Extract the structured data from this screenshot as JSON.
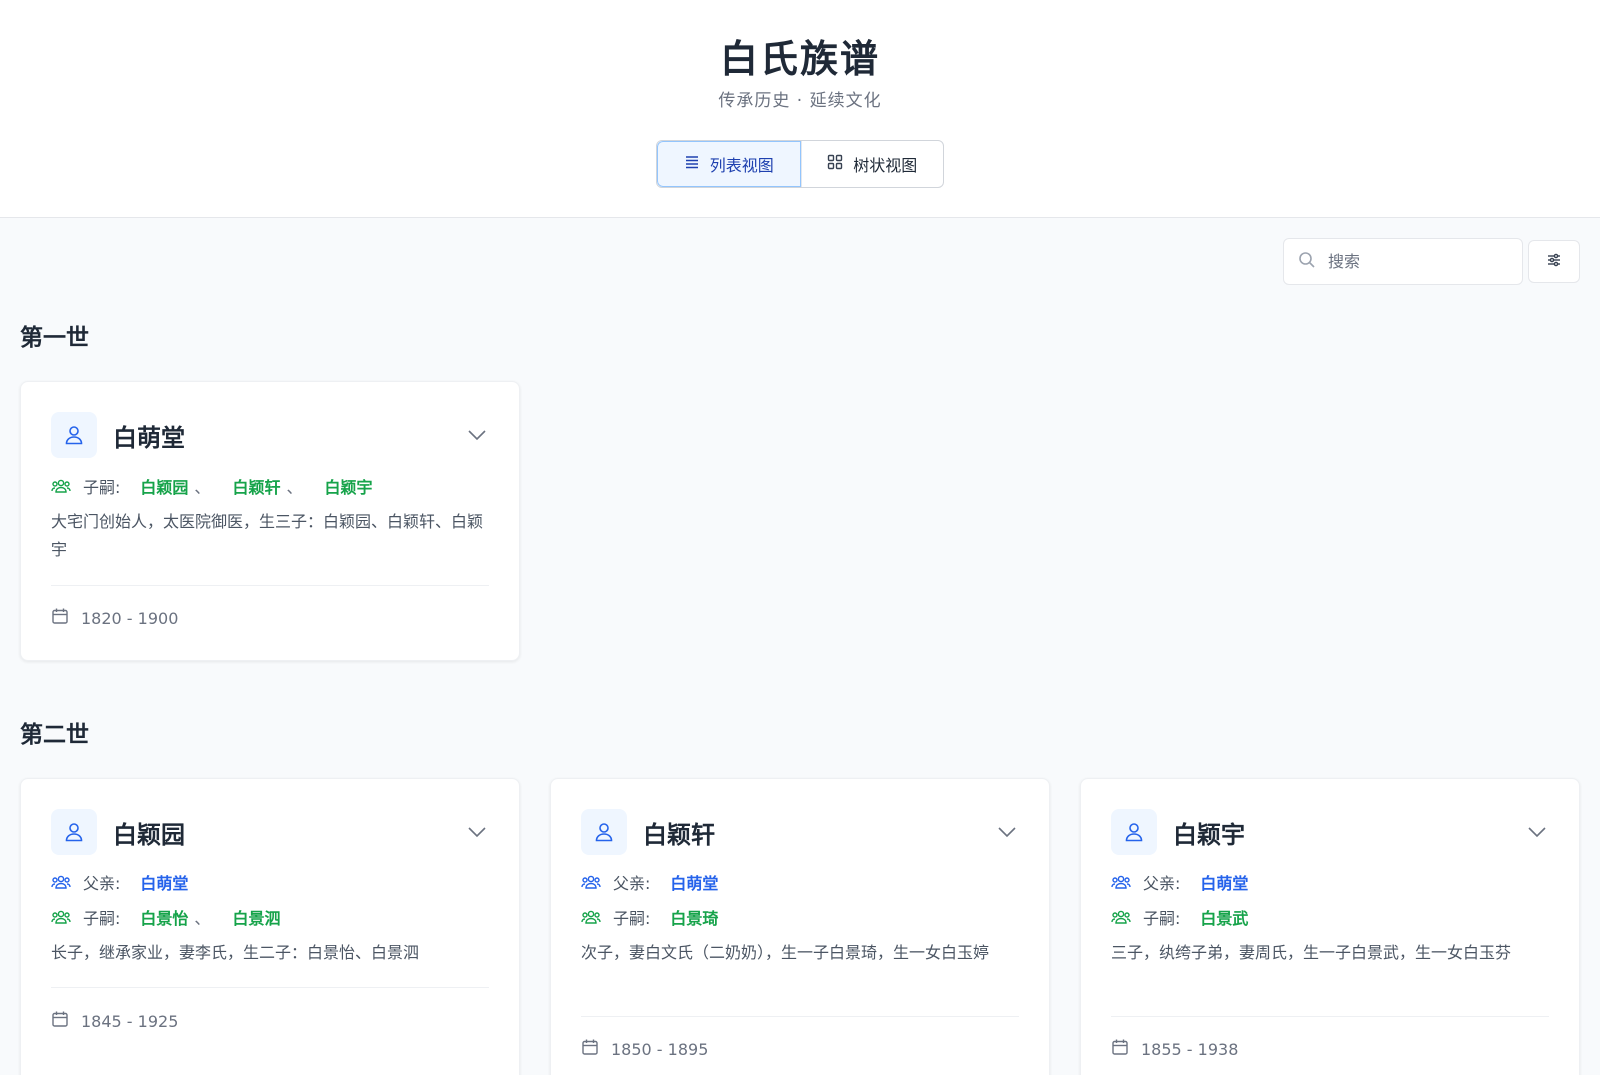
{
  "header": {
    "title": "白氏族谱",
    "subtitle": "传承历史 · 延续文化",
    "tabs": [
      {
        "label": "列表视图",
        "icon": "list-icon",
        "active": true
      },
      {
        "label": "树状视图",
        "icon": "grid-icon",
        "active": false
      }
    ]
  },
  "search": {
    "placeholder": "搜索",
    "value": ""
  },
  "labels": {
    "father": "父亲:",
    "children": "子嗣:"
  },
  "generations": [
    {
      "title": "第一世",
      "members": [
        {
          "name": "白萌堂",
          "father": null,
          "children": [
            "白颖园",
            "白颖轩",
            "白颖宇"
          ],
          "description": "大宅门创始人，太医院御医，生三子：白颖园、白颖轩、白颖宇",
          "years": "1820 - 1900"
        }
      ]
    },
    {
      "title": "第二世",
      "members": [
        {
          "name": "白颖园",
          "father": "白萌堂",
          "children": [
            "白景怡",
            "白景泗"
          ],
          "description": "长子，继承家业，妻李氏，生二子：白景怡、白景泗",
          "years": "1845 - 1925"
        },
        {
          "name": "白颖轩",
          "father": "白萌堂",
          "children": [
            "白景琦"
          ],
          "description": "次子，妻白文氏（二奶奶），生一子白景琦，生一女白玉婷",
          "years": "1850 - 1895"
        },
        {
          "name": "白颖宇",
          "father": "白萌堂",
          "children": [
            "白景武"
          ],
          "description": "三子，纨绔子弟，妻周氏，生一子白景武，生一女白玉芬",
          "years": "1855 - 1938"
        }
      ]
    }
  ],
  "colors": {
    "accent": "#2563eb",
    "children": "#16a34a",
    "father": "#2563eb"
  }
}
